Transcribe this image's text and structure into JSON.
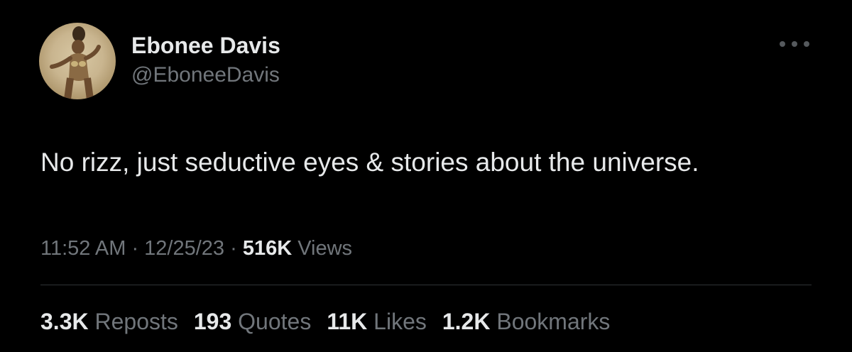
{
  "author": {
    "display_name": "Ebonee Davis",
    "handle": "@EboneeDavis"
  },
  "more_icon": "more-horizontal-icon",
  "tweet": {
    "text": "No rizz, just seductive eyes & stories about the universe."
  },
  "meta": {
    "time": "11:52 AM",
    "sep1": " · ",
    "date": "12/25/23",
    "sep2": " · ",
    "views_count": "516K",
    "views_label": " Views"
  },
  "stats": [
    {
      "count": "3.3K",
      "label": "Reposts"
    },
    {
      "count": "193",
      "label": "Quotes"
    },
    {
      "count": "11K",
      "label": "Likes"
    },
    {
      "count": "1.2K",
      "label": "Bookmarks"
    }
  ],
  "colors": {
    "background": "#000000",
    "primary_text": "#e7e9ea",
    "secondary_text": "#71767b",
    "divider": "#2f3336"
  }
}
